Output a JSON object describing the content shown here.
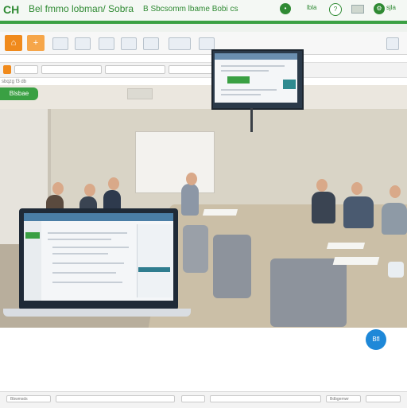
{
  "header": {
    "logo": "CH",
    "title": "Bel fmmo lobman/ Sobra",
    "subtitle": "B Sbcsomm lbame Bobi cs",
    "right_icon_1": "circle-icon",
    "right_label_1": "lbla",
    "right_icon_2": "circle-icon",
    "right_label_2": "sjla",
    "right_icon_3": "circle-icon"
  },
  "status_button": "Blsbae",
  "addr_tag": "sbqzg f3 db",
  "bottom_left": "Bbwmsds",
  "bottom_right": "Bdbgemwr",
  "fab_label": "Bfl",
  "colors": {
    "accent_green": "#3aa043",
    "fab_blue": "#1e88d8",
    "ribbon_orange": "#f08a1c"
  }
}
